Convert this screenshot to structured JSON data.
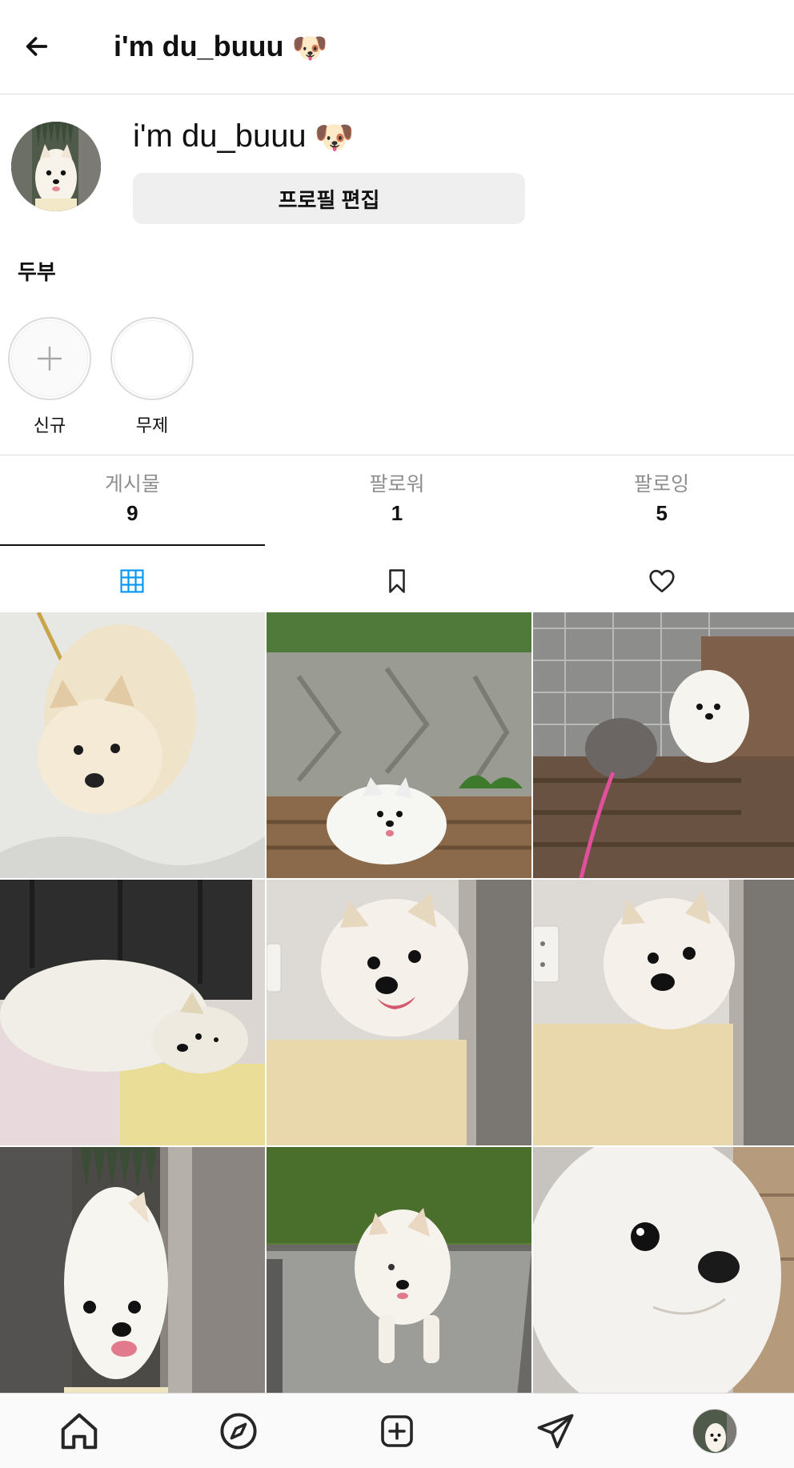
{
  "header": {
    "title": "i'm du_buuu",
    "emoji": "🐶"
  },
  "profile": {
    "display_name": "i'm du_buuu",
    "emoji": "🐶",
    "edit_button_label": "프로필 편집",
    "bio_name": "두부"
  },
  "highlights": [
    {
      "label": "신규",
      "icon": "plus-icon"
    },
    {
      "label": "무제",
      "icon": ""
    }
  ],
  "stats": [
    {
      "label": "게시물",
      "value": "9"
    },
    {
      "label": "팔로워",
      "value": "1"
    },
    {
      "label": "팔로잉",
      "value": "5"
    }
  ],
  "tabs": [
    {
      "icon": "grid-icon",
      "active": true
    },
    {
      "icon": "bookmark-icon",
      "active": false
    },
    {
      "icon": "heart-icon",
      "active": false
    }
  ],
  "grid_posts": [
    {
      "subject": "white pomeranian in snow"
    },
    {
      "subject": "pomeranian on bench by stone wall"
    },
    {
      "subject": "two dogs on wooden steps"
    },
    {
      "subject": "pomeranian lying on couch"
    },
    {
      "subject": "pomeranian smiling by door"
    },
    {
      "subject": "pomeranian resting on cushion"
    },
    {
      "subject": "pomeranian peeking through door"
    },
    {
      "subject": "pomeranian on stone slab"
    },
    {
      "subject": "pomeranian close-up"
    }
  ],
  "bottom_nav": [
    {
      "icon": "home-icon"
    },
    {
      "icon": "compass-icon"
    },
    {
      "icon": "new-post-icon"
    },
    {
      "icon": "send-icon"
    },
    {
      "icon": "profile-avatar"
    }
  ],
  "colors": {
    "active_tab": "#0095f6",
    "divider": "#dbdbdb",
    "button_bg": "#efefef",
    "muted_text": "#8e8e8e"
  }
}
